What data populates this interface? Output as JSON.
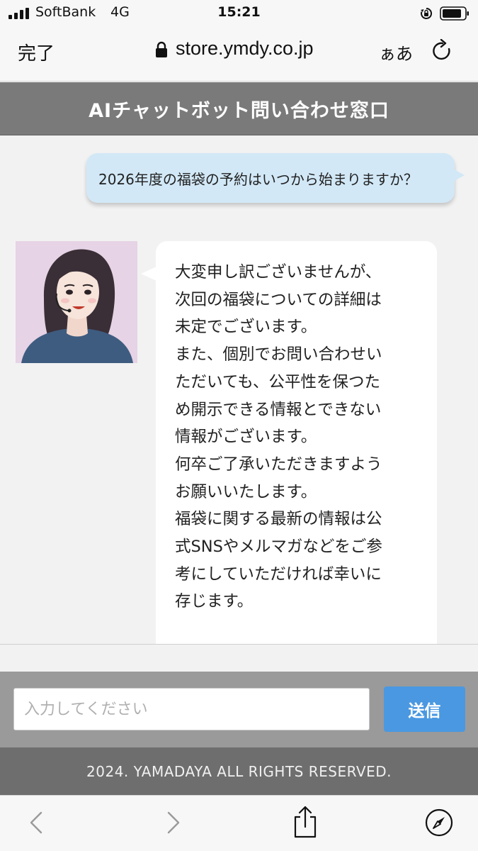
{
  "status_bar": {
    "carrier": "SoftBank",
    "network": "4G",
    "time": "15:21"
  },
  "browser": {
    "done_label": "完了",
    "url": "store.ymdy.co.jp",
    "text_size_label": "ぁあ"
  },
  "header": {
    "title": "AIチャットボット問い合わせ窓口"
  },
  "chat": {
    "user_message": "2026年度の福袋の予約はいつから始まりますか？",
    "bot_message_lines": [
      "大変申し訳ございませんが、",
      "次回の福袋についての詳細は",
      "未定でございます。",
      "また、個別でお問い合わせい",
      "ただいても、公平性を保つた",
      "め開示できる情報とできない",
      "情報がございます。",
      "何卒ご了承いただきますよう",
      "お願いいたします。",
      "福袋に関する最新の情報は公",
      "式SNSやメルマガなどをご参",
      "考にしていただければ幸いに",
      "存じます。"
    ]
  },
  "input": {
    "placeholder": "入力してください",
    "value": "",
    "send_label": "送信"
  },
  "footer": {
    "copyright": "2024. YAMADAYA ALL RIGHTS RESERVED."
  },
  "toolbar": {
    "icons": [
      "back-icon",
      "forward-icon",
      "share-icon",
      "compass-icon"
    ]
  },
  "colors": {
    "header_bg": "#7a7a7a",
    "user_bubble": "#d2e8f7",
    "send_button": "#4a98e1",
    "footer_bg": "#6e6e6e",
    "avatar_bg": "#e6d3e5"
  }
}
